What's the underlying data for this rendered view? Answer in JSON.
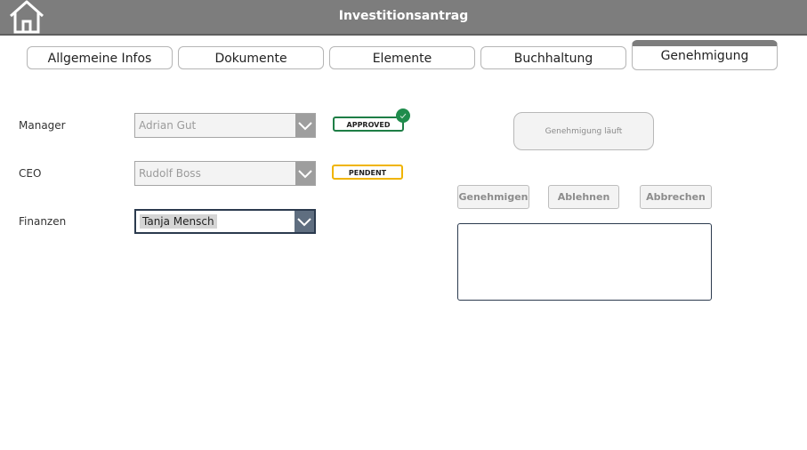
{
  "header": {
    "title": "Investitionsantrag",
    "home_icon": "home-icon"
  },
  "tabs": [
    {
      "label": "Allgemeine Infos",
      "active": false
    },
    {
      "label": "Dokumente",
      "active": false
    },
    {
      "label": "Elemente",
      "active": false
    },
    {
      "label": "Buchhaltung",
      "active": false
    },
    {
      "label": "Genehmigung",
      "active": true
    }
  ],
  "approvers": {
    "manager": {
      "label": "Manager",
      "value": "Adrian Gut",
      "status": "APPROVED",
      "status_color": "#1e7e46",
      "check_icon": "check-icon"
    },
    "ceo": {
      "label": "CEO",
      "value": "Rudolf Boss",
      "status": "PENDENT",
      "status_color": "#f0b400"
    },
    "finanzen": {
      "label": "Finanzen",
      "value": "Tanja Mensch"
    }
  },
  "actions": {
    "status_button": "Genehmigung läuft",
    "approve": "Genehmigen",
    "reject": "Ablehnen",
    "cancel": "Abbrechen",
    "comment_value": ""
  },
  "colors": {
    "header_bg": "#7d7d7d",
    "accent_dark": "#2b3a4e",
    "approved": "#1e7e46",
    "pendent": "#f0b400"
  }
}
